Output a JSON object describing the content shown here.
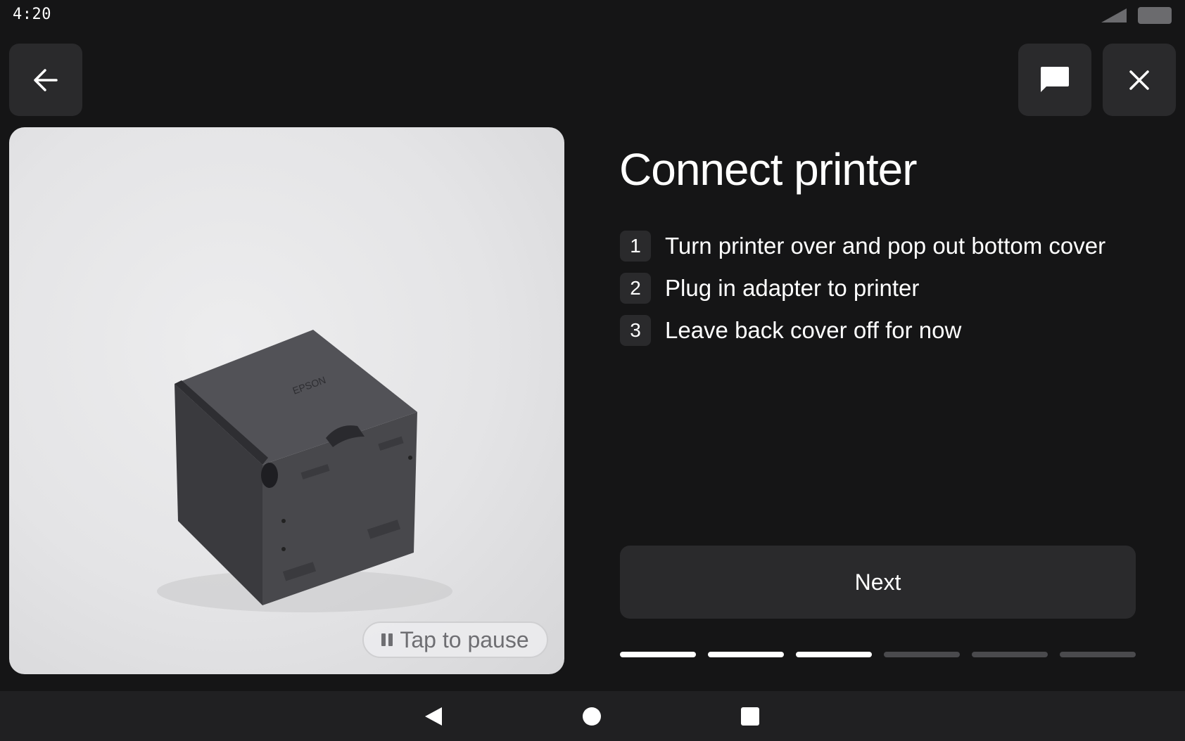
{
  "status_bar": {
    "time": "4:20",
    "signal_icon": "cellular-signal-icon",
    "battery_icon": "battery-icon"
  },
  "toolbar": {
    "back_icon": "arrow-left-icon",
    "chat_icon": "chat-bubble-icon",
    "close_icon": "close-icon"
  },
  "video": {
    "pause_label": "Tap to pause",
    "pause_icon": "pause-icon",
    "printer_brand": "EPSON"
  },
  "main": {
    "title": "Connect printer",
    "steps": [
      {
        "number": "1",
        "text": "Turn printer over and pop out bottom cover"
      },
      {
        "number": "2",
        "text": "Plug in adapter to printer"
      },
      {
        "number": "3",
        "text": "Leave back cover off for now"
      }
    ],
    "next_label": "Next",
    "progress": {
      "current": 3,
      "total": 6
    }
  },
  "nav_bar": {
    "back_icon": "nav-back-triangle-icon",
    "home_icon": "nav-home-circle-icon",
    "recents_icon": "nav-recents-square-icon"
  },
  "colors": {
    "background": "#151516",
    "surface": "#2a2a2c",
    "text": "#ffffff",
    "progress_inactive": "#4a4a4d",
    "video_background": "#e6e6e8"
  }
}
